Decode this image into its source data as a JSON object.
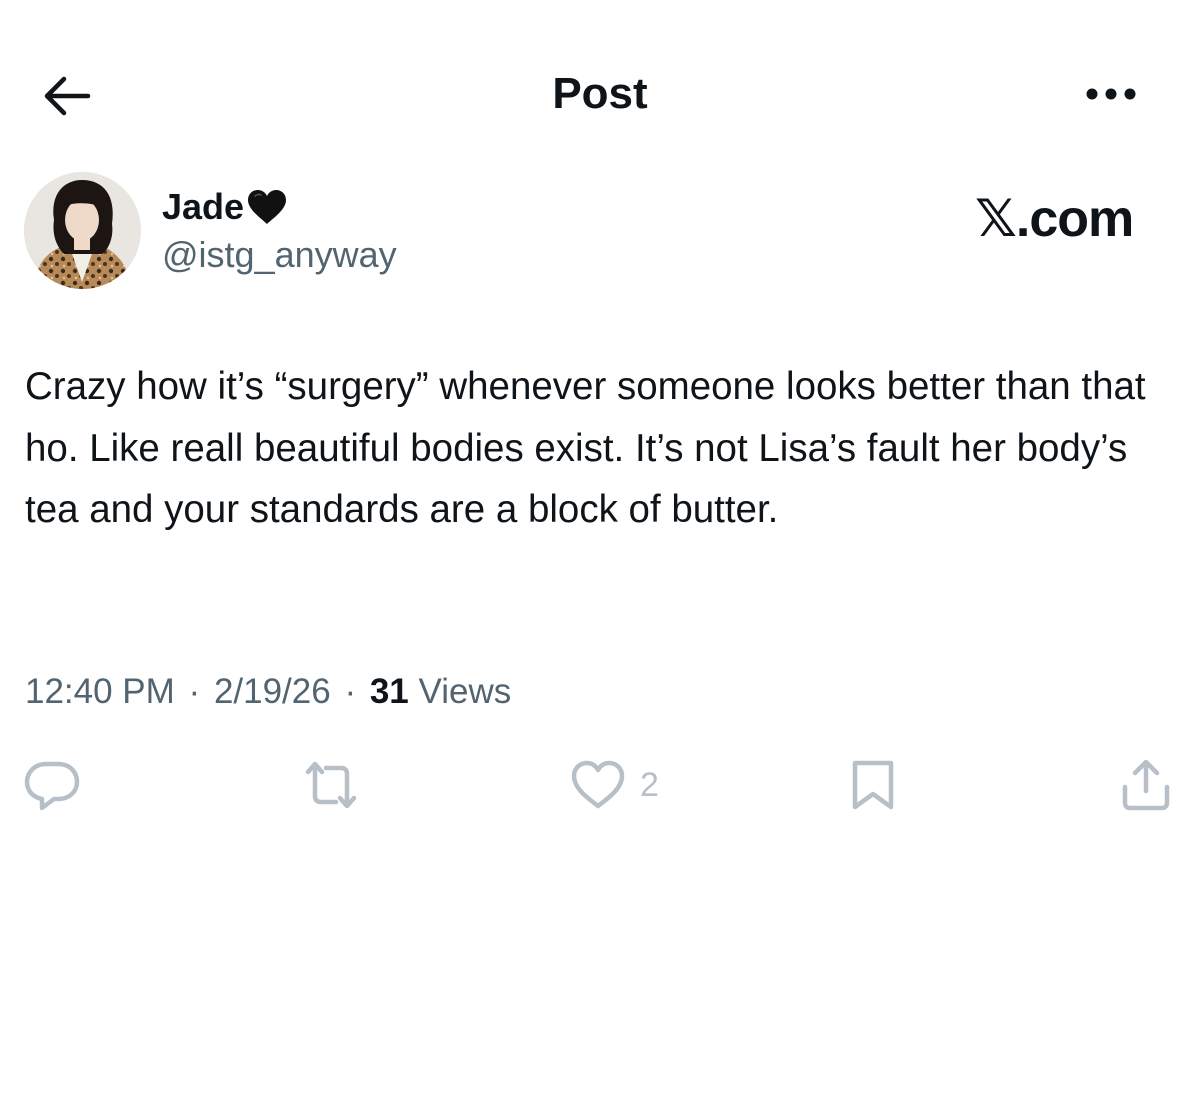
{
  "header": {
    "back_icon": "arrow-left-icon",
    "title": "Post",
    "more_icon": "more-horizontal-icon"
  },
  "author": {
    "avatar_icon": "avatar",
    "name": "Jade",
    "name_badge_icon": "black-heart-icon",
    "handle": "@istg_anyway"
  },
  "source": "𝕏.com",
  "post": {
    "text": "Crazy how it’s “surgery” whenever someone looks better than that ho. Like reall beautiful bodies exist. It’s not Lisa’s fault her body’s tea and your standards are a block of butter."
  },
  "meta": {
    "time": "12:40 PM",
    "separator": "·",
    "date": "2/19/26",
    "views_count": "31",
    "views_label": "Views"
  },
  "actions": {
    "reply_icon": "reply-icon",
    "repost_icon": "repost-icon",
    "like_icon": "heart-icon",
    "like_count": "2",
    "bookmark_icon": "bookmark-icon",
    "share_icon": "share-icon"
  },
  "colors": {
    "text_primary": "#0f1419",
    "text_secondary": "#536471",
    "action_icon": "#b7c0c8",
    "background": "#ffffff"
  }
}
